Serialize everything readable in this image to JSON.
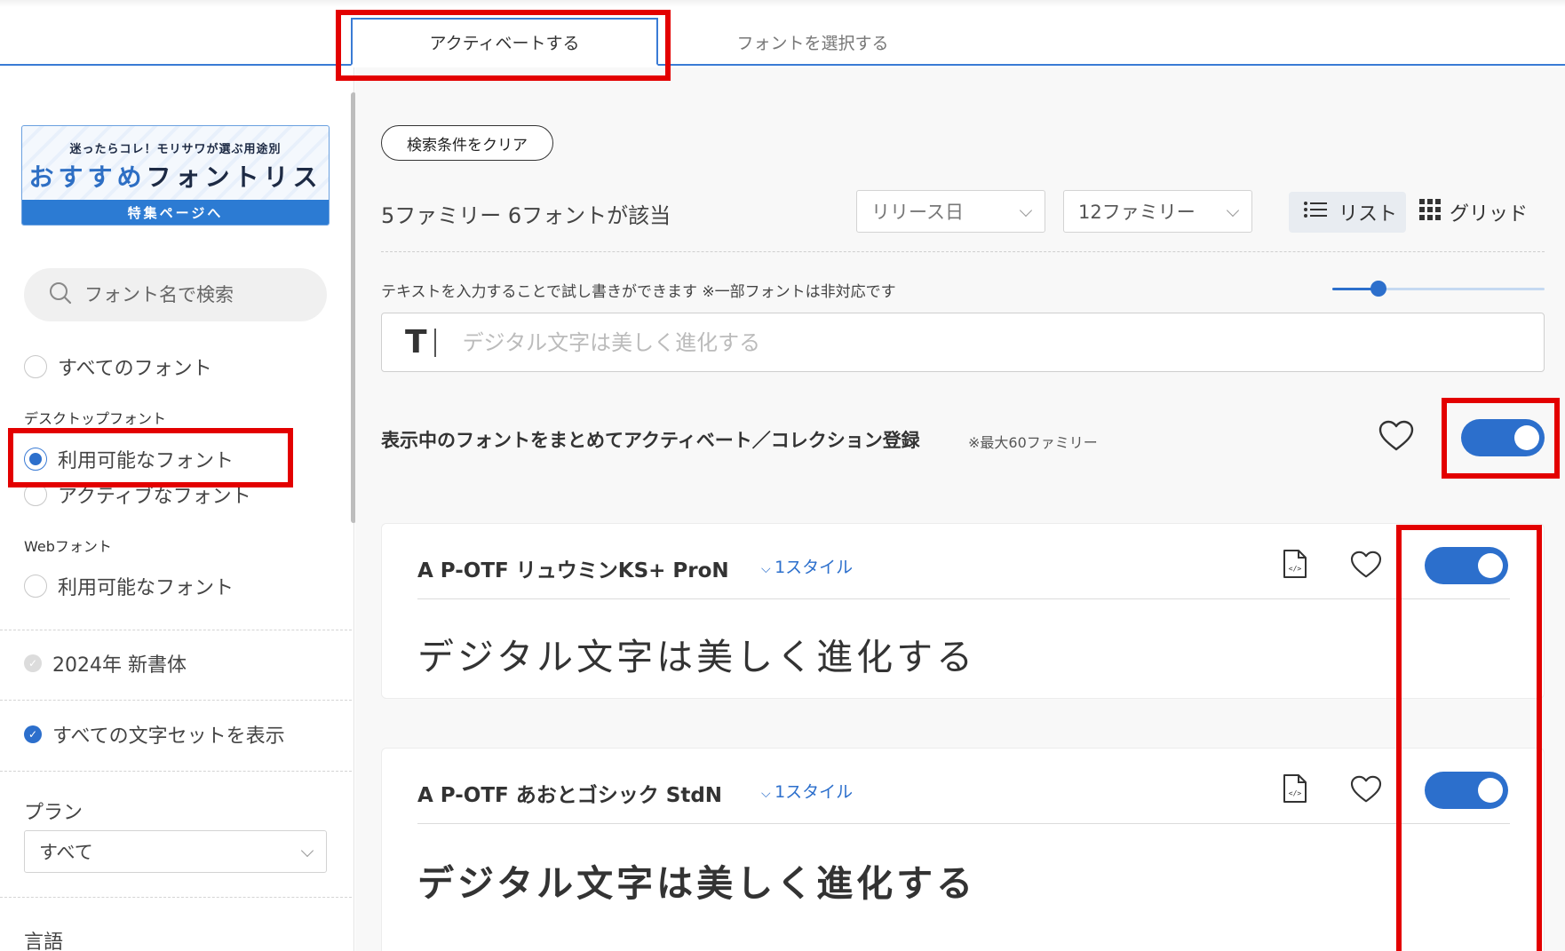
{
  "tabs": {
    "activate": "アクティベートする",
    "select_fonts": "フォントを選択する"
  },
  "banner": {
    "top_line": "迷ったらコレ！モリサワが選ぶ用途別",
    "main_blue": "おすすめ",
    "main_rest": "フォントリスト",
    "cta": "特集ページへ"
  },
  "sidebar": {
    "search_placeholder": "フォント名で検索",
    "all_fonts": "すべてのフォント",
    "desktop_heading": "デスクトップフォント",
    "desktop_available": "利用可能なフォント",
    "desktop_active": "アクティブなフォント",
    "web_heading": "Webフォント",
    "web_available": "利用可能なフォント",
    "new_2024": "2024年 新書体",
    "show_all_charsets": "すべての文字セットを表示",
    "plan_label": "プラン",
    "plan_value": "すべて",
    "language_label": "言語"
  },
  "main": {
    "clear_button": "検索条件をクリア",
    "result_count": "5ファミリー 6フォントが該当",
    "sort_value": "リリース日",
    "per_page_value": "12ファミリー",
    "view_list": "リスト",
    "view_grid": "グリッド",
    "hint": "テキストを入力することで試し書きができます ※一部フォントは非対応です",
    "preview_glyph": "T",
    "preview_placeholder": "デジタル文字は美しく進化する",
    "bulk_label": "表示中のフォントをまとめてアクティベート／コレクション登録",
    "bulk_note": "※最大60ファミリー"
  },
  "fonts": [
    {
      "name": "A P-OTF リュウミンKS+ ProN",
      "styles": "1スタイル",
      "sample": "デジタル文字は美しく進化する"
    },
    {
      "name": "A P-OTF あおとゴシック StdN",
      "styles": "1スタイル",
      "sample": "デジタル文字は美しく進化する"
    }
  ],
  "state": {
    "bulk_toggle_on": true,
    "font_toggles_on": [
      true,
      true
    ],
    "preview_size_slider": 0.22
  },
  "colors": {
    "accent": "#2c6fcc",
    "highlight": "#e30000"
  }
}
